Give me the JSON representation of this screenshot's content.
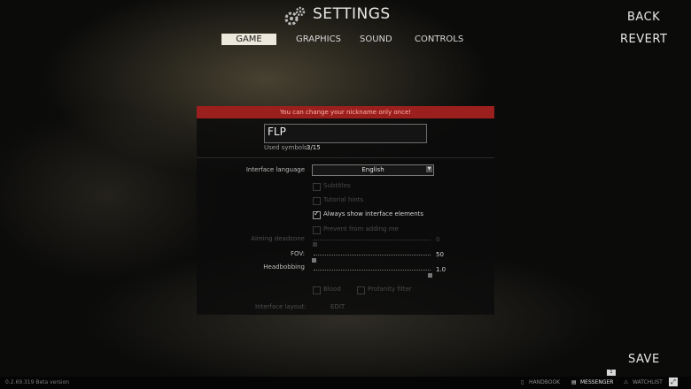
{
  "header": {
    "title": "SETTINGS",
    "tabs": [
      {
        "label": "GAME",
        "active": true
      },
      {
        "label": "GRAPHICS",
        "active": false
      },
      {
        "label": "SOUND",
        "active": false
      },
      {
        "label": "CONTROLS",
        "active": false
      }
    ]
  },
  "actions": {
    "back": "BACK",
    "revert": "REVERT",
    "save": "SAVE"
  },
  "panel": {
    "banner": "You can change your nickname only once!",
    "nickname": {
      "value": "FLP",
      "symbols_label": "Used symbols:",
      "symbols_value": "3/15"
    },
    "interface_language": {
      "label": "Interface language",
      "value": "English"
    },
    "checkboxes": [
      {
        "label": "Subtitles",
        "checked": false,
        "enabled": false
      },
      {
        "label": "Tutorial hints",
        "checked": false,
        "enabled": false
      },
      {
        "label": "Always show interface elements",
        "checked": true,
        "enabled": true
      },
      {
        "label": "Prevent from adding me",
        "checked": false,
        "enabled": false
      }
    ],
    "sliders": [
      {
        "label": "Aiming deadzone",
        "value": "0",
        "enabled": false
      },
      {
        "label": "FOV:",
        "value": "50",
        "enabled": true
      },
      {
        "label": "Headbobbing",
        "value": "1.0",
        "enabled": true
      }
    ],
    "options": [
      {
        "label": "Blood",
        "checked": false
      },
      {
        "label": "Profanity filter",
        "checked": false
      }
    ],
    "interface_layout": {
      "label": "Interface layout:",
      "action": "EDIT"
    }
  },
  "bottom_bar": {
    "version": "0.2.69.319 Beta version",
    "items": [
      "HANDBOOK",
      "MESSENGER",
      "WATCHLIST"
    ],
    "messenger_count": "1"
  },
  "colors": {
    "banner": "#9b1f1d",
    "active_tab": "#ece9dc",
    "panel": "#0c0c0c"
  }
}
